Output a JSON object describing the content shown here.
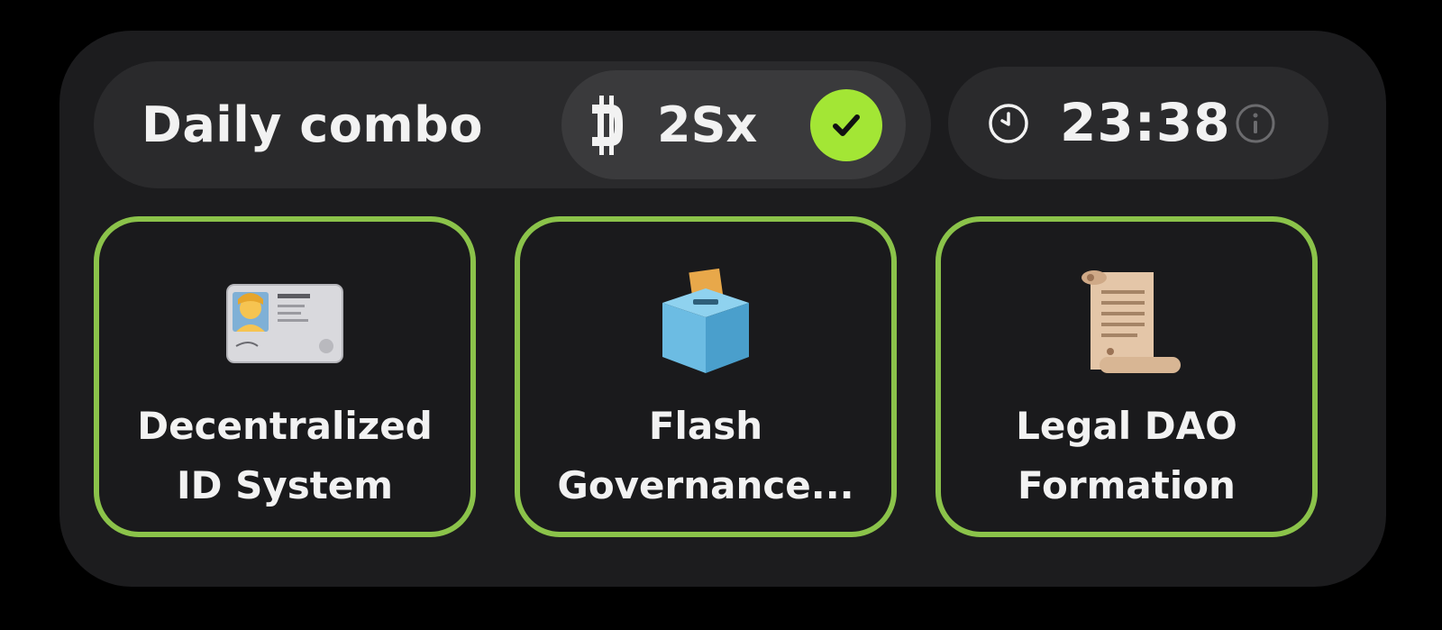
{
  "header": {
    "title": "Daily combo",
    "reward": {
      "icon": "coin-icon",
      "amount": "2Sx",
      "claimed_icon": "check-icon"
    },
    "timer": {
      "icon": "clock-icon",
      "value": "23:38",
      "info_icon": "info-icon"
    }
  },
  "cards": [
    {
      "icon": "id-card-icon",
      "line1": "Decentralized",
      "line2": "ID System"
    },
    {
      "icon": "ballot-box-icon",
      "line1": "Flash",
      "line2": "Governance..."
    },
    {
      "icon": "scroll-icon",
      "line1": "Legal DAO",
      "line2": "Formation"
    }
  ],
  "colors": {
    "accent": "#8bc34a",
    "check_badge": "#a3e635",
    "panel": "#1c1c1e",
    "pill": "#2a2a2c",
    "text": "#f2f2f2"
  }
}
